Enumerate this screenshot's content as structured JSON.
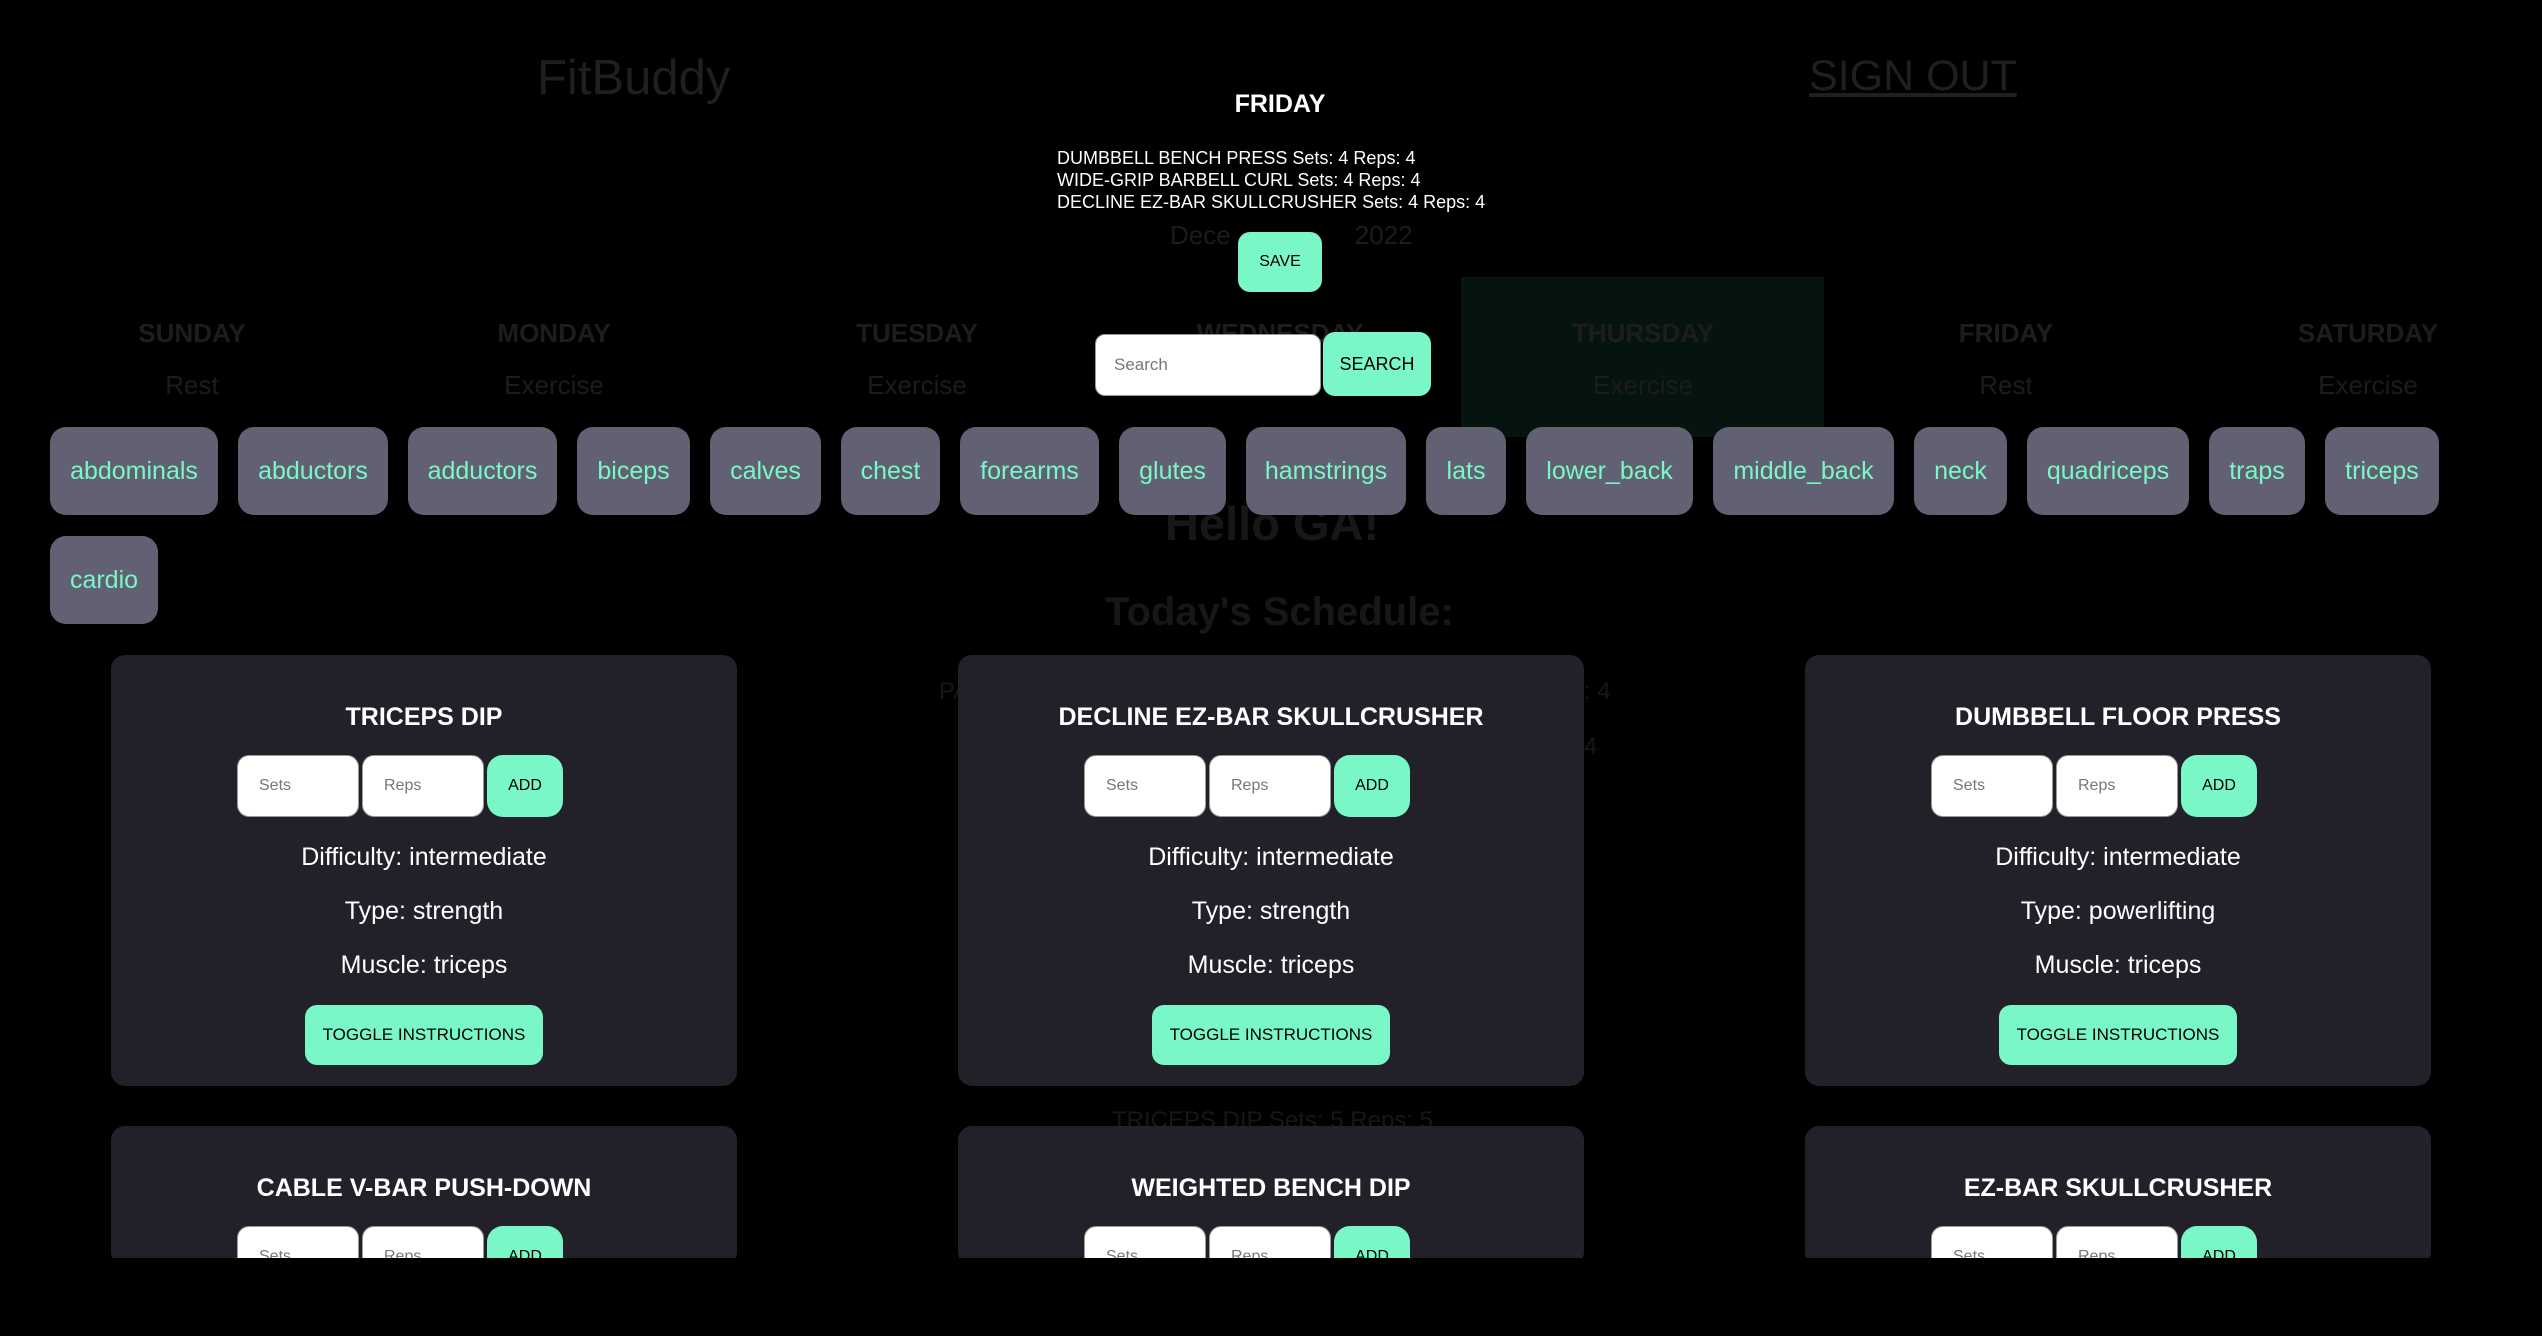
{
  "background": {
    "brand": "FitBuddy",
    "sign_out": "SIGN OUT",
    "date_parts": [
      "Dece",
      "2022"
    ],
    "days": [
      {
        "name": "SUNDAY",
        "status": "Rest"
      },
      {
        "name": "MONDAY",
        "status": "Exercise"
      },
      {
        "name": "TUESDAY",
        "status": "Exercise"
      },
      {
        "name": "WEDNESDAY",
        "status": ""
      },
      {
        "name": "THURSDAY",
        "status": "Exercise"
      },
      {
        "name": "FRIDAY",
        "status": "Rest"
      },
      {
        "name": "SATURDAY",
        "status": "Exercise"
      }
    ],
    "greeting": "Hello GA!",
    "schedule_heading": "Today's Schedule:",
    "fragments": [
      "PA",
      "s: 4",
      "4"
    ],
    "schedule_item": "TRICEPS DIP Sets: 5 Reps: 5"
  },
  "modal": {
    "day_title": "FRIDAY",
    "workout_list": [
      "DUMBBELL BENCH PRESS Sets: 4 Reps: 4",
      "WIDE-GRIP BARBELL CURL Sets: 4 Reps: 4",
      "DECLINE EZ-BAR SKULLCRUSHER Sets: 4 Reps: 4"
    ],
    "save_label": "SAVE",
    "search_placeholder": "Search",
    "search_label": "SEARCH"
  },
  "muscles": [
    "abdominals",
    "abductors",
    "adductors",
    "biceps",
    "calves",
    "chest",
    "forearms",
    "glutes",
    "hamstrings",
    "lats",
    "lower_back",
    "middle_back",
    "neck",
    "quadriceps",
    "traps",
    "triceps",
    "cardio"
  ],
  "card_ui": {
    "sets_placeholder": "Sets",
    "reps_placeholder": "Reps",
    "add_label": "ADD",
    "toggle_label": "TOGGLE INSTRUCTIONS"
  },
  "exercises": [
    {
      "name": "TRICEPS DIP",
      "difficulty": "Difficulty: intermediate",
      "type": "Type: strength",
      "muscle": "Muscle: triceps"
    },
    {
      "name": "DECLINE EZ-BAR SKULLCRUSHER",
      "difficulty": "Difficulty: intermediate",
      "type": "Type: strength",
      "muscle": "Muscle: triceps"
    },
    {
      "name": "DUMBBELL FLOOR PRESS",
      "difficulty": "Difficulty: intermediate",
      "type": "Type: powerlifting",
      "muscle": "Muscle: triceps"
    },
    {
      "name": "CABLE V-BAR PUSH-DOWN"
    },
    {
      "name": "WEIGHTED BENCH DIP"
    },
    {
      "name": "EZ-BAR SKULLCRUSHER"
    }
  ],
  "colors": {
    "accent": "#79f7c7",
    "chip_bg": "#626173",
    "card_bg": "#22212a",
    "page_bg": "#000000"
  }
}
